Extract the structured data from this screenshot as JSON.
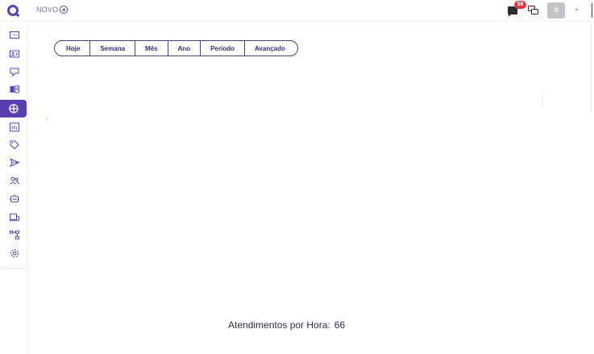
{
  "header": {
    "new_label": "NOVO",
    "notification_count": "58",
    "avatar_letter": "a"
  },
  "sidebar": {
    "items": [
      {
        "icon": "chat-icon"
      },
      {
        "icon": "contact-card-icon"
      },
      {
        "icon": "message-board-icon"
      },
      {
        "icon": "book-icon"
      },
      {
        "icon": "dashboard-icon",
        "active": true
      },
      {
        "icon": "reports-icon"
      },
      {
        "icon": "tag-icon"
      },
      {
        "icon": "send-icon"
      },
      {
        "icon": "users-icon"
      },
      {
        "icon": "bot-icon"
      },
      {
        "icon": "devices-icon"
      },
      {
        "icon": "flow-icon"
      },
      {
        "icon": "settings-icon"
      }
    ]
  },
  "filters": [
    "Hoje",
    "Semana",
    "Mês",
    "Ano",
    "Período",
    "Avançado"
  ],
  "stats": {
    "label": "Atendimentos por Hora:",
    "value": "66"
  },
  "colors": {
    "accent": "#5b3fb1",
    "badge": "#e8323c"
  }
}
